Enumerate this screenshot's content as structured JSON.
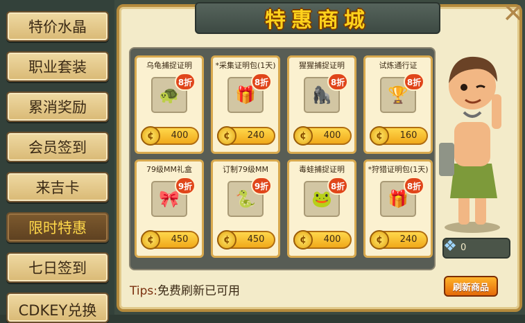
{
  "menu": {
    "items": [
      {
        "label": "特价水晶",
        "active": false
      },
      {
        "label": "职业套装",
        "active": false
      },
      {
        "label": "累消奖励",
        "active": false
      },
      {
        "label": "会员签到",
        "active": false
      },
      {
        "label": "来吉卡",
        "active": false
      },
      {
        "label": "限时特惠",
        "active": true
      },
      {
        "label": "七日签到",
        "active": false
      },
      {
        "label": "CDKEY兑换",
        "active": false
      }
    ]
  },
  "shop": {
    "title": "特惠商城",
    "items": [
      {
        "name": "乌龟捕捉证明",
        "discount": "8折",
        "price": "400",
        "icon": "turtle-badge-icon"
      },
      {
        "name": "*采集证明包(1天)",
        "discount": "8折",
        "price": "240",
        "icon": "gift-bag-icon"
      },
      {
        "name": "猩猩捕捉证明",
        "discount": "8折",
        "price": "400",
        "icon": "ape-badge-icon"
      },
      {
        "name": "试炼通行证",
        "discount": "8折",
        "price": "160",
        "icon": "trial-pass-icon"
      },
      {
        "name": "79级MM礼盒",
        "discount": "9折",
        "price": "450",
        "icon": "gift-box-icon"
      },
      {
        "name": "订制79级MM",
        "discount": "9折",
        "price": "450",
        "icon": "pet-figure-icon"
      },
      {
        "name": "毒蛙捕捉证明",
        "discount": "8折",
        "price": "400",
        "icon": "frog-badge-icon"
      },
      {
        "name": "*狩猎证明包(1天)",
        "discount": "8折",
        "price": "240",
        "icon": "gift-bag-icon"
      }
    ],
    "tips_label": "Tips:",
    "tips_text": "免费刷新已可用",
    "gem_value": "0",
    "refresh_label": "刷新商品"
  }
}
